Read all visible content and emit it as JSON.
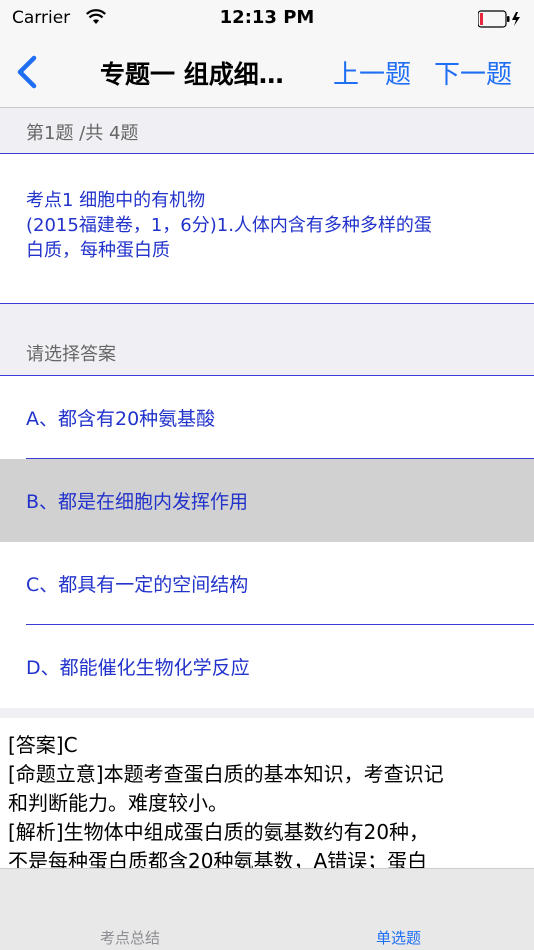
{
  "status_bar": {
    "carrier": "Carrier",
    "time": "12:13 PM"
  },
  "nav": {
    "title": "专题一  组成细…",
    "prev_label": "上一题",
    "next_label": "下一题"
  },
  "counter": "第1题 /共 4题",
  "question": {
    "lines": [
      "考点1  细胞中的有机物",
      "(2015福建卷，1，6分)1.人体内含有多种多样的蛋",
      "白质，每种蛋白质"
    ]
  },
  "choose_label": "请选择答案",
  "options": [
    {
      "label": "A、都含有20种氨基酸",
      "selected": false
    },
    {
      "label": "B、都是在细胞内发挥作用",
      "selected": true
    },
    {
      "label": "C、都具有一定的空间结构",
      "selected": false
    },
    {
      "label": "D、都能催化生物化学反应",
      "selected": false
    }
  ],
  "analysis": {
    "lines": [
      "[答案]C",
      "[命题立意]本题考查蛋白质的基本知识，考查识记",
      "和判断能力。难度较小。",
      "[解析]生物体中组成蛋白质的氨基数约有20种，",
      "不是每种蛋白质都含20种氨基数，A错误；蛋白"
    ]
  },
  "tabs": [
    {
      "label": "考点总结",
      "active": false
    },
    {
      "label": "单选题",
      "active": true
    }
  ],
  "colors": {
    "accent": "#1f6ff5",
    "option_text": "#2233cc",
    "divider": "#3b3bd6",
    "selected_row": "#d1d1d1",
    "battery_low": "#e8273d"
  }
}
